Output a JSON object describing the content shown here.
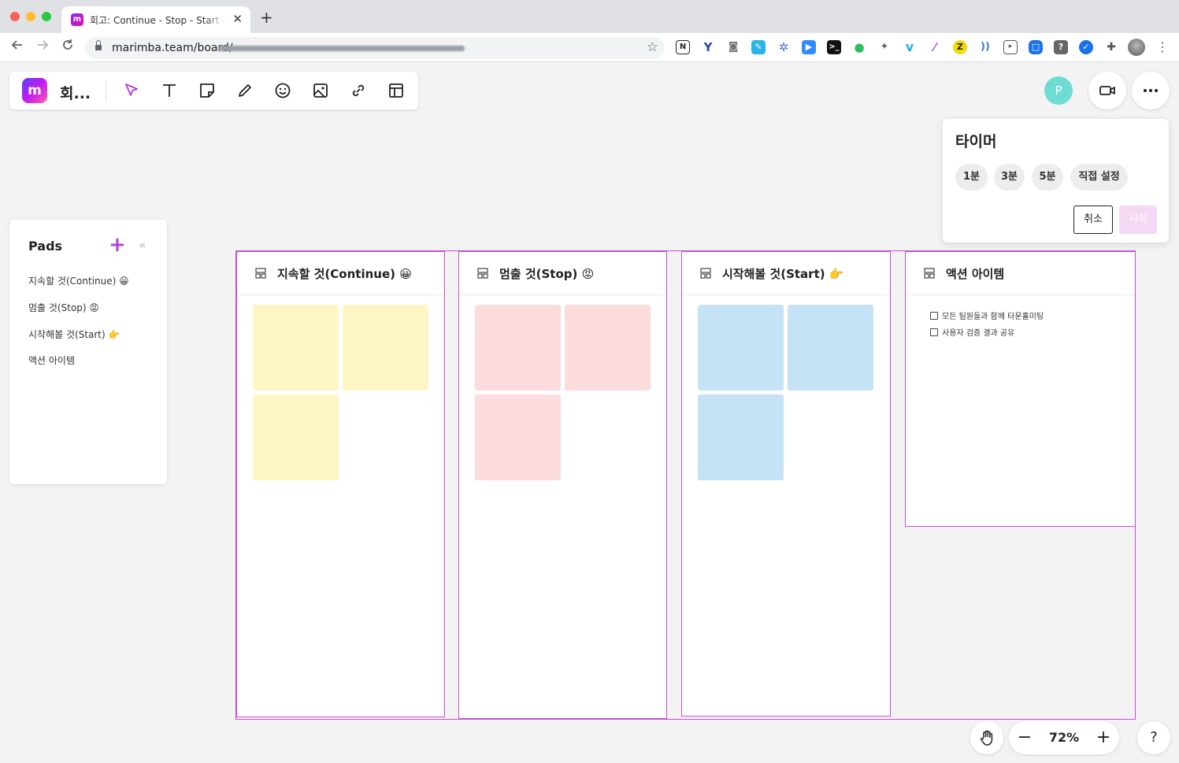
{
  "browser": {
    "tab_title": "회고: Continue - Stop - Start - 마",
    "tab_favicon": "m",
    "url": "marimba.team/board/",
    "new_tab": "+",
    "close": "✕"
  },
  "toolbar": {
    "logo": "m",
    "board_title": "회...",
    "tools": [
      "select-icon",
      "text-icon",
      "sticky-note-icon",
      "pen-icon",
      "emoji-icon",
      "image-icon",
      "link-icon",
      "template-icon"
    ]
  },
  "header_right": {
    "avatar_initial": "P",
    "avatar_color": "#6edcd3"
  },
  "timer": {
    "title": "타이머",
    "presets": [
      "1분",
      "3분",
      "5분",
      "직접 설정"
    ],
    "cancel_label": "취소",
    "start_label": "시작"
  },
  "pads": {
    "title": "Pads",
    "add": "+",
    "collapse": "«",
    "items": [
      "지속할 것(Continue) 😀",
      "멈출 것(Stop) 😡",
      "시작해볼 것(Start) 👉",
      "액션 아이템"
    ]
  },
  "columns": [
    {
      "title": "지속할 것(Continue) 😀",
      "sticky_color": "yellow",
      "sticky_count": 3
    },
    {
      "title": "멈출 것(Stop) 😡",
      "sticky_color": "pink",
      "sticky_count": 3
    },
    {
      "title": "시작해볼 것(Start) 👉",
      "sticky_color": "blue",
      "sticky_count": 3
    },
    {
      "title": "액션 아이템",
      "todos": [
        "모든 팀원들과 함께 타운홀미팅",
        "사용자 검증 결과 공유"
      ]
    }
  ],
  "zoom": {
    "minus": "−",
    "value": "72%",
    "plus": "+"
  },
  "help": "?",
  "colors": {
    "accent": "#c64fd0",
    "sticky_yellow": "#fff6c5",
    "sticky_pink": "#fcdcdc",
    "sticky_blue": "#c5e2f7"
  }
}
